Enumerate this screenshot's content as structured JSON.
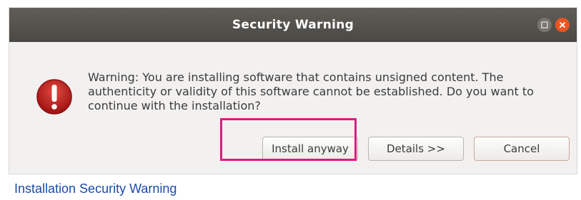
{
  "window": {
    "title": "Security Warning"
  },
  "dialog": {
    "icon": "warning-exclamation-icon",
    "message": "Warning: You are installing software that contains unsigned content. The authenticity or validity of this software cannot be established. Do you want to continue with the installation?"
  },
  "buttons": {
    "install_label": "Install anyway",
    "details_label": "Details >>",
    "cancel_label": "Cancel"
  },
  "highlight": {
    "target": "install-anyway-button",
    "color": "#e0197e"
  },
  "caption": {
    "text": "Installation Security Warning"
  },
  "colors": {
    "titlebar": "#4f4e49",
    "close_button": "#e95420",
    "warning_icon": "#b71c1c",
    "caption": "#1a4aa8"
  }
}
